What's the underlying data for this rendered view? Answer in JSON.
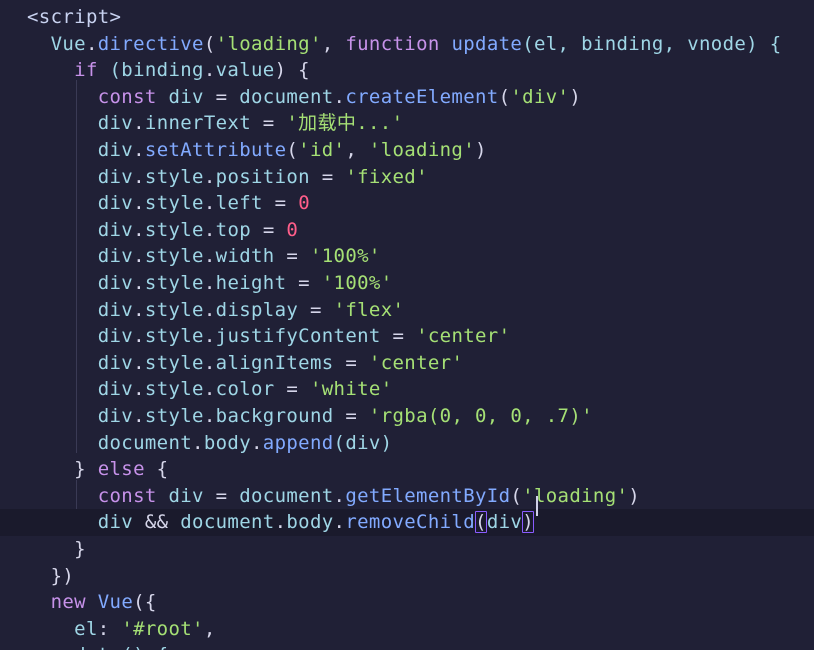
{
  "editor": {
    "colors": {
      "background": "#202036",
      "current_line": "#1a1a2c",
      "keyword": "#c792ea",
      "function": "#82aaff",
      "string": "#a5e075",
      "number": "#ff5e8a",
      "variable": "#9fd6e6"
    },
    "lines": [
      {
        "tokens": [
          {
            "t": "<script>",
            "c": "tag"
          }
        ]
      },
      {
        "tokens": [
          {
            "t": "  Vue",
            "c": "obj"
          },
          {
            "t": ".",
            "c": "punc"
          },
          {
            "t": "directive",
            "c": "fn"
          },
          {
            "t": "(",
            "c": "punc"
          },
          {
            "t": "'loading'",
            "c": "str"
          },
          {
            "t": ", ",
            "c": "punc"
          },
          {
            "t": "function",
            "c": "kw"
          },
          {
            "t": " ",
            "c": "punc"
          },
          {
            "t": "update",
            "c": "fn"
          },
          {
            "t": "(el, binding, vnode) {",
            "c": "var"
          }
        ]
      },
      {
        "tokens": [
          {
            "t": "    if",
            "c": "kw"
          },
          {
            "t": " (binding",
            "c": "var"
          },
          {
            "t": ".",
            "c": "punc"
          },
          {
            "t": "value",
            "c": "var"
          },
          {
            "t": ") {",
            "c": "punc"
          }
        ]
      },
      {
        "tokens": [
          {
            "t": "      const",
            "c": "kw"
          },
          {
            "t": " div ",
            "c": "var"
          },
          {
            "t": "= ",
            "c": "op"
          },
          {
            "t": "document",
            "c": "var"
          },
          {
            "t": ".",
            "c": "punc"
          },
          {
            "t": "createElement",
            "c": "fn"
          },
          {
            "t": "(",
            "c": "punc"
          },
          {
            "t": "'div'",
            "c": "str"
          },
          {
            "t": ")",
            "c": "punc"
          }
        ]
      },
      {
        "tokens": [
          {
            "t": "      div",
            "c": "var"
          },
          {
            "t": ".",
            "c": "punc"
          },
          {
            "t": "innerText",
            "c": "var"
          },
          {
            "t": " = ",
            "c": "op"
          },
          {
            "t": "'加载中...'",
            "c": "str"
          }
        ]
      },
      {
        "tokens": [
          {
            "t": "      div",
            "c": "var"
          },
          {
            "t": ".",
            "c": "punc"
          },
          {
            "t": "setAttribute",
            "c": "fn"
          },
          {
            "t": "(",
            "c": "punc"
          },
          {
            "t": "'id'",
            "c": "str"
          },
          {
            "t": ", ",
            "c": "punc"
          },
          {
            "t": "'loading'",
            "c": "str"
          },
          {
            "t": ")",
            "c": "punc"
          }
        ]
      },
      {
        "tokens": [
          {
            "t": "      div",
            "c": "var"
          },
          {
            "t": ".",
            "c": "punc"
          },
          {
            "t": "style",
            "c": "var"
          },
          {
            "t": ".",
            "c": "punc"
          },
          {
            "t": "position",
            "c": "var"
          },
          {
            "t": " = ",
            "c": "op"
          },
          {
            "t": "'fixed'",
            "c": "str"
          }
        ]
      },
      {
        "tokens": [
          {
            "t": "      div",
            "c": "var"
          },
          {
            "t": ".",
            "c": "punc"
          },
          {
            "t": "style",
            "c": "var"
          },
          {
            "t": ".",
            "c": "punc"
          },
          {
            "t": "left",
            "c": "var"
          },
          {
            "t": " = ",
            "c": "op"
          },
          {
            "t": "0",
            "c": "num"
          }
        ]
      },
      {
        "tokens": [
          {
            "t": "      div",
            "c": "var"
          },
          {
            "t": ".",
            "c": "punc"
          },
          {
            "t": "style",
            "c": "var"
          },
          {
            "t": ".",
            "c": "punc"
          },
          {
            "t": "top",
            "c": "var"
          },
          {
            "t": " = ",
            "c": "op"
          },
          {
            "t": "0",
            "c": "num"
          }
        ]
      },
      {
        "tokens": [
          {
            "t": "      div",
            "c": "var"
          },
          {
            "t": ".",
            "c": "punc"
          },
          {
            "t": "style",
            "c": "var"
          },
          {
            "t": ".",
            "c": "punc"
          },
          {
            "t": "width",
            "c": "var"
          },
          {
            "t": " = ",
            "c": "op"
          },
          {
            "t": "'100%'",
            "c": "str"
          }
        ]
      },
      {
        "tokens": [
          {
            "t": "      div",
            "c": "var"
          },
          {
            "t": ".",
            "c": "punc"
          },
          {
            "t": "style",
            "c": "var"
          },
          {
            "t": ".",
            "c": "punc"
          },
          {
            "t": "height",
            "c": "var"
          },
          {
            "t": " = ",
            "c": "op"
          },
          {
            "t": "'100%'",
            "c": "str"
          }
        ]
      },
      {
        "tokens": [
          {
            "t": "      div",
            "c": "var"
          },
          {
            "t": ".",
            "c": "punc"
          },
          {
            "t": "style",
            "c": "var"
          },
          {
            "t": ".",
            "c": "punc"
          },
          {
            "t": "display",
            "c": "var"
          },
          {
            "t": " = ",
            "c": "op"
          },
          {
            "t": "'flex'",
            "c": "str"
          }
        ]
      },
      {
        "tokens": [
          {
            "t": "      div",
            "c": "var"
          },
          {
            "t": ".",
            "c": "punc"
          },
          {
            "t": "style",
            "c": "var"
          },
          {
            "t": ".",
            "c": "punc"
          },
          {
            "t": "justifyContent",
            "c": "var"
          },
          {
            "t": " = ",
            "c": "op"
          },
          {
            "t": "'center'",
            "c": "str"
          }
        ]
      },
      {
        "tokens": [
          {
            "t": "      div",
            "c": "var"
          },
          {
            "t": ".",
            "c": "punc"
          },
          {
            "t": "style",
            "c": "var"
          },
          {
            "t": ".",
            "c": "punc"
          },
          {
            "t": "alignItems",
            "c": "var"
          },
          {
            "t": " = ",
            "c": "op"
          },
          {
            "t": "'center'",
            "c": "str"
          }
        ]
      },
      {
        "tokens": [
          {
            "t": "      div",
            "c": "var"
          },
          {
            "t": ".",
            "c": "punc"
          },
          {
            "t": "style",
            "c": "var"
          },
          {
            "t": ".",
            "c": "punc"
          },
          {
            "t": "color",
            "c": "var"
          },
          {
            "t": " = ",
            "c": "op"
          },
          {
            "t": "'white'",
            "c": "str"
          }
        ]
      },
      {
        "tokens": [
          {
            "t": "      div",
            "c": "var"
          },
          {
            "t": ".",
            "c": "punc"
          },
          {
            "t": "style",
            "c": "var"
          },
          {
            "t": ".",
            "c": "punc"
          },
          {
            "t": "background",
            "c": "var"
          },
          {
            "t": " = ",
            "c": "op"
          },
          {
            "t": "'rgba(0, 0, 0, .7)'",
            "c": "str"
          }
        ]
      },
      {
        "tokens": [
          {
            "t": "      document",
            "c": "var"
          },
          {
            "t": ".",
            "c": "punc"
          },
          {
            "t": "body",
            "c": "var"
          },
          {
            "t": ".",
            "c": "punc"
          },
          {
            "t": "append",
            "c": "fn"
          },
          {
            "t": "(div)",
            "c": "var"
          }
        ]
      },
      {
        "tokens": [
          {
            "t": "    } ",
            "c": "punc"
          },
          {
            "t": "else",
            "c": "kw"
          },
          {
            "t": " {",
            "c": "punc"
          }
        ]
      },
      {
        "tokens": [
          {
            "t": "      const",
            "c": "kw"
          },
          {
            "t": " div ",
            "c": "var"
          },
          {
            "t": "= ",
            "c": "op"
          },
          {
            "t": "document",
            "c": "var"
          },
          {
            "t": ".",
            "c": "punc"
          },
          {
            "t": "getElementById",
            "c": "fn"
          },
          {
            "t": "(",
            "c": "punc"
          },
          {
            "t": "'loading'",
            "c": "str"
          },
          {
            "t": ")",
            "c": "punc"
          }
        ]
      },
      {
        "current": true,
        "tokens": [
          {
            "t": "      div ",
            "c": "var"
          },
          {
            "t": "&&",
            "c": "op"
          },
          {
            "t": " document",
            "c": "var"
          },
          {
            "t": ".",
            "c": "punc"
          },
          {
            "t": "body",
            "c": "var"
          },
          {
            "t": ".",
            "c": "punc"
          },
          {
            "t": "removeChild",
            "c": "fn"
          },
          {
            "t": "(",
            "c": "punc",
            "match": true
          },
          {
            "t": "div",
            "c": "var"
          },
          {
            "t": ")",
            "c": "punc",
            "match": true
          }
        ]
      },
      {
        "tokens": [
          {
            "t": "    }",
            "c": "punc"
          }
        ]
      },
      {
        "tokens": [
          {
            "t": "  })",
            "c": "punc"
          }
        ]
      },
      {
        "tokens": [
          {
            "t": "  new",
            "c": "kw"
          },
          {
            "t": " ",
            "c": "punc"
          },
          {
            "t": "Vue",
            "c": "fn"
          },
          {
            "t": "({",
            "c": "punc"
          }
        ]
      },
      {
        "tokens": [
          {
            "t": "    el",
            "c": "var"
          },
          {
            "t": ": ",
            "c": "punc"
          },
          {
            "t": "'#root'",
            "c": "str"
          },
          {
            "t": ",",
            "c": "punc"
          }
        ]
      },
      {
        "tokens": [
          {
            "t": "    data() {",
            "c": "var"
          }
        ]
      }
    ]
  }
}
